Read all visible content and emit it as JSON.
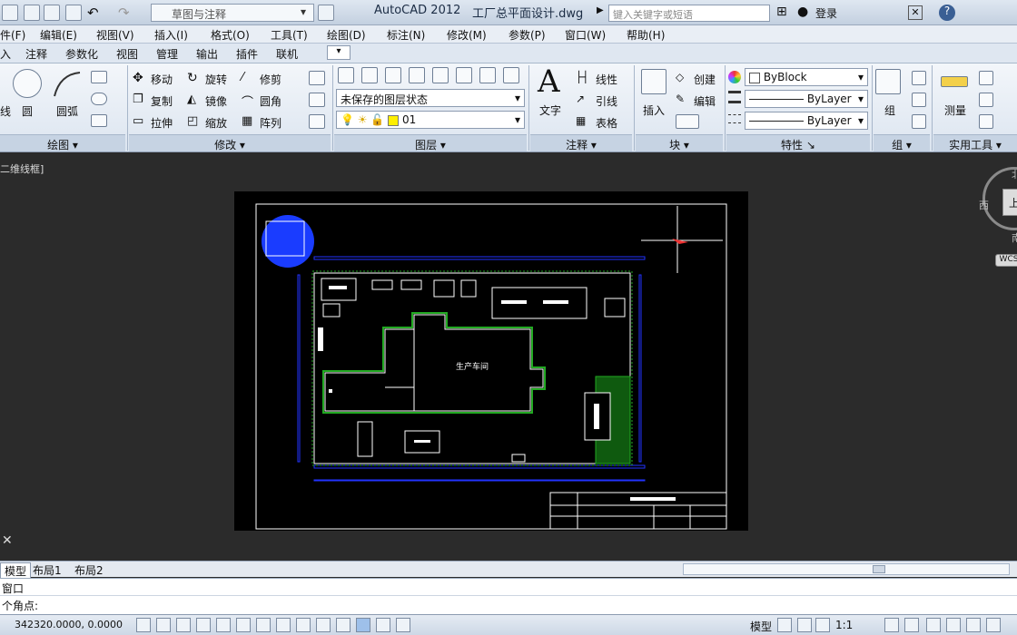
{
  "window": {
    "app_name": "AutoCAD 2012",
    "doc_name": "工厂总平面设计.dwg",
    "workspace": "草图与注释",
    "search_placeholder": "键入关键字或短语",
    "login": "登录"
  },
  "menu": [
    "件(F)",
    "编辑(E)",
    "视图(V)",
    "插入(I)",
    "格式(O)",
    "工具(T)",
    "绘图(D)",
    "标注(N)",
    "修改(M)",
    "参数(P)",
    "窗口(W)",
    "帮助(H)"
  ],
  "ribbon_tabs": [
    "入",
    "注释",
    "参数化",
    "视图",
    "管理",
    "输出",
    "插件",
    "联机"
  ],
  "ribbon": {
    "draw": {
      "title": "绘图",
      "line": "线",
      "circle": "圆",
      "arc": "圆弧"
    },
    "modify": {
      "title": "修改",
      "move": "移动",
      "rotate": "旋转",
      "trim": "修剪",
      "copy": "复制",
      "mirror": "镜像",
      "fillet": "圆角",
      "stretch": "拉伸",
      "scale": "缩放",
      "array": "阵列"
    },
    "layers": {
      "title": "图层",
      "state": "未保存的图层状态",
      "current": "01"
    },
    "annotation": {
      "title": "注释",
      "text": "文字",
      "dim_linear": "线性",
      "leader": "引线",
      "table": "表格"
    },
    "block": {
      "title": "块",
      "insert": "插入",
      "create": "创建",
      "edit": "编辑"
    },
    "properties": {
      "title": "特性",
      "color": "ByBlock",
      "linetype": "ByLayer",
      "lineweight": "ByLayer"
    },
    "groups": {
      "title": "组",
      "group": "组"
    },
    "utilities": {
      "title": "实用工具",
      "measure": "测量"
    }
  },
  "viewport": {
    "label": "二维线框]",
    "drawing_text": "生产车间",
    "viewcube": {
      "west": "西",
      "north": "北",
      "south": "南",
      "top": "上",
      "wcs": "WCS"
    }
  },
  "layout_tabs": [
    "模型",
    "布局1",
    "布局2"
  ],
  "command": {
    "history": "窗口",
    "prompt": "个角点:"
  },
  "status": {
    "coords": "342320.0000, 0.0000",
    "model": "模型",
    "scale": "1:1"
  },
  "colors": {
    "accent": "#1f4e8c",
    "drawing_bg": "#000000",
    "model_space": "#2b2b2b",
    "layer_blue": "#1a3cff",
    "green_hatch": "#22aa22"
  }
}
